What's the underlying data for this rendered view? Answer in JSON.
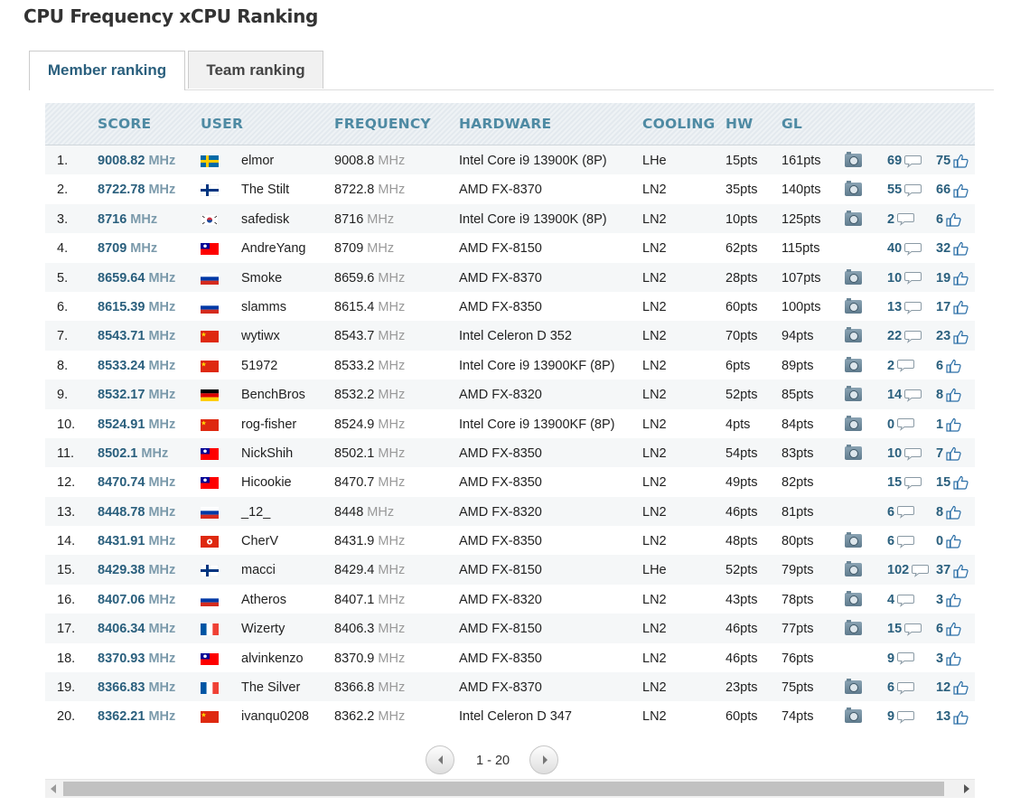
{
  "title": "CPU Frequency xCPU Ranking",
  "tabs": [
    {
      "label": "Member ranking",
      "active": true
    },
    {
      "label": "Team ranking",
      "active": false
    }
  ],
  "columns": {
    "score": "SCORE",
    "user": "USER",
    "frequency": "FREQUENCY",
    "hardware": "HARDWARE",
    "cooling": "COOLING",
    "hw": "HW",
    "gl": "GL"
  },
  "unit": "MHz",
  "rows": [
    {
      "rank": "1.",
      "score": "9008.82",
      "flag": "se",
      "user": "elmor",
      "freq": "9008.8",
      "hardware": "Intel Core i9 13900K (8P)",
      "cooling": "LHe",
      "hw": "15pts",
      "gl": "161pts",
      "camera": true,
      "comments": "69",
      "likes": "75"
    },
    {
      "rank": "2.",
      "score": "8722.78",
      "flag": "fi",
      "user": "The Stilt",
      "freq": "8722.8",
      "hardware": "AMD FX-8370",
      "cooling": "LN2",
      "hw": "35pts",
      "gl": "140pts",
      "camera": true,
      "comments": "55",
      "likes": "66"
    },
    {
      "rank": "3.",
      "score": "8716",
      "flag": "kr",
      "user": "safedisk",
      "freq": "8716",
      "hardware": "Intel Core i9 13900K (8P)",
      "cooling": "LN2",
      "hw": "10pts",
      "gl": "125pts",
      "camera": true,
      "comments": "2",
      "likes": "6"
    },
    {
      "rank": "4.",
      "score": "8709",
      "flag": "tw",
      "user": "AndreYang",
      "freq": "8709",
      "hardware": "AMD FX-8150",
      "cooling": "LN2",
      "hw": "62pts",
      "gl": "115pts",
      "camera": false,
      "comments": "40",
      "likes": "32"
    },
    {
      "rank": "5.",
      "score": "8659.64",
      "flag": "ru",
      "user": "Smoke",
      "freq": "8659.6",
      "hardware": "AMD FX-8370",
      "cooling": "LN2",
      "hw": "28pts",
      "gl": "107pts",
      "camera": true,
      "comments": "10",
      "likes": "19"
    },
    {
      "rank": "6.",
      "score": "8615.39",
      "flag": "ru",
      "user": "slamms",
      "freq": "8615.4",
      "hardware": "AMD FX-8350",
      "cooling": "LN2",
      "hw": "60pts",
      "gl": "100pts",
      "camera": true,
      "comments": "13",
      "likes": "17"
    },
    {
      "rank": "7.",
      "score": "8543.71",
      "flag": "cn",
      "user": "wytiwx",
      "freq": "8543.7",
      "hardware": "Intel Celeron D 352",
      "cooling": "LN2",
      "hw": "70pts",
      "gl": "94pts",
      "camera": true,
      "comments": "22",
      "likes": "23"
    },
    {
      "rank": "8.",
      "score": "8533.24",
      "flag": "cn",
      "user": "51972",
      "freq": "8533.2",
      "hardware": "Intel Core i9 13900KF (8P)",
      "cooling": "LN2",
      "hw": "6pts",
      "gl": "89pts",
      "camera": true,
      "comments": "2",
      "likes": "6"
    },
    {
      "rank": "9.",
      "score": "8532.17",
      "flag": "de",
      "user": "BenchBros",
      "freq": "8532.2",
      "hardware": "AMD FX-8320",
      "cooling": "LN2",
      "hw": "52pts",
      "gl": "85pts",
      "camera": true,
      "comments": "14",
      "likes": "8"
    },
    {
      "rank": "10.",
      "score": "8524.91",
      "flag": "cn",
      "user": "rog-fisher",
      "freq": "8524.9",
      "hardware": "Intel Core i9 13900KF (8P)",
      "cooling": "LN2",
      "hw": "4pts",
      "gl": "84pts",
      "camera": true,
      "comments": "0",
      "likes": "1"
    },
    {
      "rank": "11.",
      "score": "8502.1",
      "flag": "tw",
      "user": "NickShih",
      "freq": "8502.1",
      "hardware": "AMD FX-8350",
      "cooling": "LN2",
      "hw": "54pts",
      "gl": "83pts",
      "camera": true,
      "comments": "10",
      "likes": "7"
    },
    {
      "rank": "12.",
      "score": "8470.74",
      "flag": "tw",
      "user": "Hicookie",
      "freq": "8470.7",
      "hardware": "AMD FX-8350",
      "cooling": "LN2",
      "hw": "49pts",
      "gl": "82pts",
      "camera": false,
      "comments": "15",
      "likes": "15"
    },
    {
      "rank": "13.",
      "score": "8448.78",
      "flag": "ru",
      "user": "_12_",
      "freq": "8448",
      "hardware": "AMD FX-8320",
      "cooling": "LN2",
      "hw": "46pts",
      "gl": "81pts",
      "camera": false,
      "comments": "6",
      "likes": "8"
    },
    {
      "rank": "14.",
      "score": "8431.91",
      "flag": "hk",
      "user": "CherV",
      "freq": "8431.9",
      "hardware": "AMD FX-8350",
      "cooling": "LN2",
      "hw": "48pts",
      "gl": "80pts",
      "camera": true,
      "comments": "6",
      "likes": "0"
    },
    {
      "rank": "15.",
      "score": "8429.38",
      "flag": "fi",
      "user": "macci",
      "freq": "8429.4",
      "hardware": "AMD FX-8150",
      "cooling": "LHe",
      "hw": "52pts",
      "gl": "79pts",
      "camera": true,
      "comments": "102",
      "likes": "37"
    },
    {
      "rank": "16.",
      "score": "8407.06",
      "flag": "ru",
      "user": "Atheros",
      "freq": "8407.1",
      "hardware": "AMD FX-8320",
      "cooling": "LN2",
      "hw": "43pts",
      "gl": "78pts",
      "camera": true,
      "comments": "4",
      "likes": "3"
    },
    {
      "rank": "17.",
      "score": "8406.34",
      "flag": "fr",
      "user": "Wizerty",
      "freq": "8406.3",
      "hardware": "AMD FX-8150",
      "cooling": "LN2",
      "hw": "46pts",
      "gl": "77pts",
      "camera": true,
      "comments": "15",
      "likes": "6"
    },
    {
      "rank": "18.",
      "score": "8370.93",
      "flag": "tw",
      "user": "alvinkenzo",
      "freq": "8370.9",
      "hardware": "AMD FX-8350",
      "cooling": "LN2",
      "hw": "46pts",
      "gl": "76pts",
      "camera": false,
      "comments": "9",
      "likes": "3"
    },
    {
      "rank": "19.",
      "score": "8366.83",
      "flag": "fr",
      "user": "The Silver",
      "freq": "8366.8",
      "hardware": "AMD FX-8370",
      "cooling": "LN2",
      "hw": "23pts",
      "gl": "75pts",
      "camera": true,
      "comments": "6",
      "likes": "12"
    },
    {
      "rank": "20.",
      "score": "8362.21",
      "flag": "cn",
      "user": "ivanqu0208",
      "freq": "8362.2",
      "hardware": "Intel Celeron D 347",
      "cooling": "LN2",
      "hw": "60pts",
      "gl": "74pts",
      "camera": true,
      "comments": "9",
      "likes": "13"
    }
  ],
  "pagination": {
    "label": "1 - 20"
  },
  "icons": {
    "camera": "camera-icon",
    "comment": "comment-icon",
    "like": "thumbs-up-icon",
    "prev": "chevron-left-icon",
    "next": "chevron-right-icon"
  },
  "colors": {
    "accent": "#2a5f7d",
    "header_text": "#4e8aa3"
  }
}
